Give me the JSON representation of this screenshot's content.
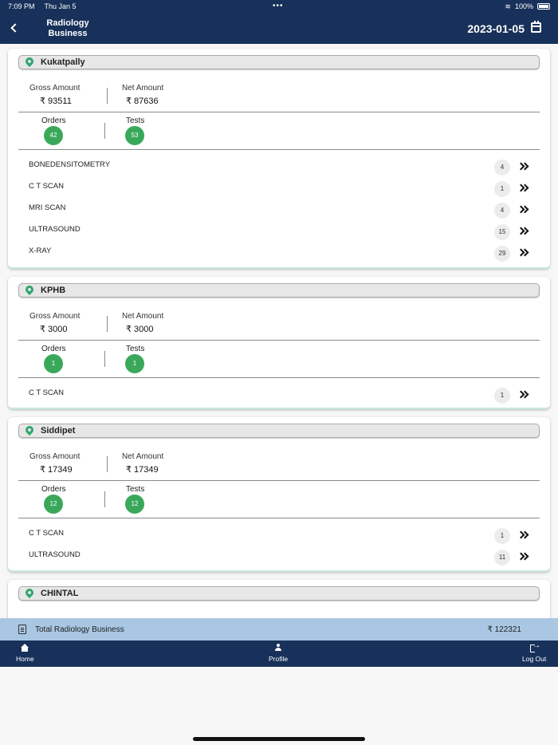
{
  "status_bar": {
    "time": "7:09 PM",
    "date": "Thu Jan 5",
    "battery": "100%"
  },
  "header": {
    "title": "Radiology Business",
    "date": "2023-01-05"
  },
  "labels": {
    "gross": "Gross Amount",
    "net": "Net Amount",
    "orders": "Orders",
    "tests": "Tests"
  },
  "locations": [
    {
      "name": "Kukatpally",
      "gross": "₹ 93511",
      "net": "₹ 87636",
      "orders": "42",
      "tests": "53",
      "items": [
        {
          "name": "BONEDENSITOMETRY",
          "count": "4"
        },
        {
          "name": "C T SCAN",
          "count": "1"
        },
        {
          "name": "MRI SCAN",
          "count": "4"
        },
        {
          "name": "ULTRASOUND",
          "count": "15"
        },
        {
          "name": "X-RAY",
          "count": "29"
        }
      ]
    },
    {
      "name": "KPHB",
      "gross": "₹ 3000",
      "net": "₹ 3000",
      "orders": "1",
      "tests": "1",
      "items": [
        {
          "name": "C T SCAN",
          "count": "1"
        }
      ]
    },
    {
      "name": "Siddipet",
      "gross": "₹ 17349",
      "net": "₹ 17349",
      "orders": "12",
      "tests": "12",
      "items": [
        {
          "name": "C T SCAN",
          "count": "1"
        },
        {
          "name": "ULTRASOUND",
          "count": "11"
        }
      ]
    },
    {
      "name": "CHINTAL"
    }
  ],
  "total": {
    "label": "Total Radiology Business",
    "value": "₹ 122321"
  },
  "tabs": {
    "home": "Home",
    "profile": "Profile",
    "logout": "Log Out"
  },
  "icons": {
    "back": "chevron-left-icon",
    "calendar": "calendar-icon",
    "location": "map-pin-icon",
    "forward": "double-chevron-right-icon"
  },
  "colors": {
    "navy": "#17315a",
    "green": "#3aa85a",
    "total_bar": "#a9c7e2"
  }
}
